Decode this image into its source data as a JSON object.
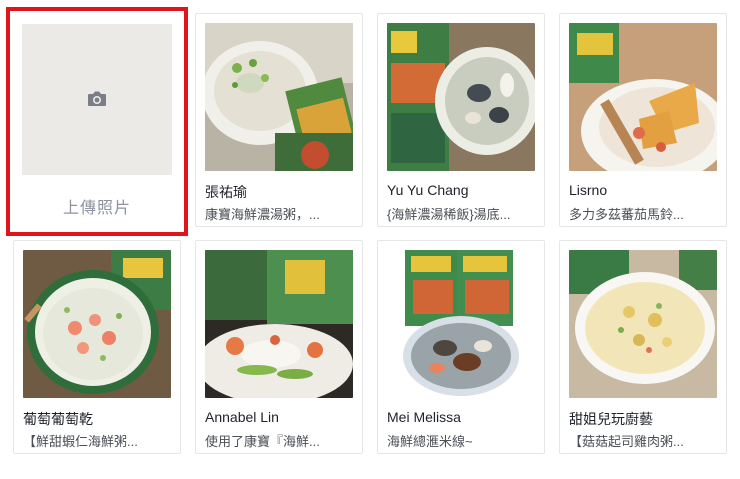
{
  "upload": {
    "label": "上傳照片",
    "icon": "camera-icon"
  },
  "cards": [
    {
      "name": "張祐瑜",
      "desc": "康寶海鮮濃湯粥，..."
    },
    {
      "name": "Yu Yu Chang",
      "desc": "{海鮮濃湯稀飯}湯底..."
    },
    {
      "name": "Lisrno",
      "desc": "多力多茲蕃茄馬鈴..."
    },
    {
      "name": "葡萄葡萄乾",
      "desc": "【鮮甜蝦仁海鮮粥..."
    },
    {
      "name": "Annabel Lin",
      "desc": "使用了康寶『海鮮..."
    },
    {
      "name": "Mei Melissa",
      "desc": "海鮮總滙米線~"
    },
    {
      "name": "甜姐兒玩廚藝",
      "desc": "【菇菇起司雞肉粥..."
    }
  ],
  "colors": {
    "highlight_border": "#e0141b",
    "placeholder_bg": "#eceae6",
    "card_border": "#e6e6e6"
  }
}
